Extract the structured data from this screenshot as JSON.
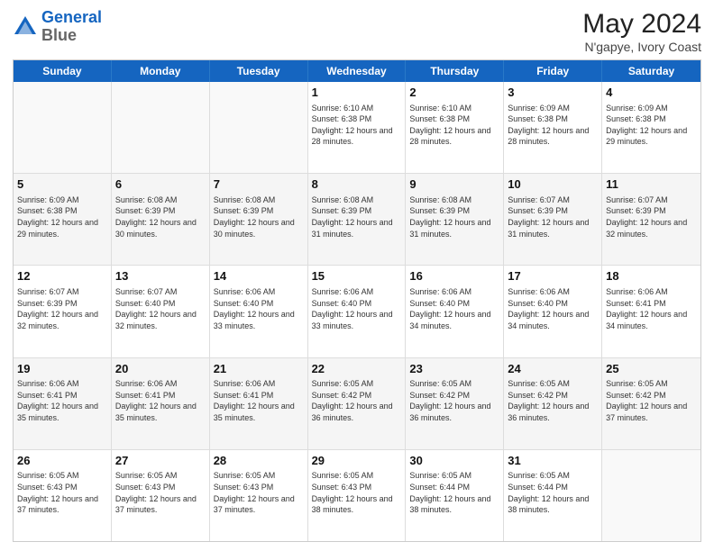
{
  "header": {
    "logo_line1": "General",
    "logo_line2": "Blue",
    "month_year": "May 2024",
    "location": "N'gapye, Ivory Coast"
  },
  "days_of_week": [
    "Sunday",
    "Monday",
    "Tuesday",
    "Wednesday",
    "Thursday",
    "Friday",
    "Saturday"
  ],
  "weeks": [
    [
      {
        "day": "",
        "sunrise": "",
        "sunset": "",
        "daylight": "",
        "empty": true
      },
      {
        "day": "",
        "sunrise": "",
        "sunset": "",
        "daylight": "",
        "empty": true
      },
      {
        "day": "",
        "sunrise": "",
        "sunset": "",
        "daylight": "",
        "empty": true
      },
      {
        "day": "1",
        "sunrise": "Sunrise: 6:10 AM",
        "sunset": "Sunset: 6:38 PM",
        "daylight": "Daylight: 12 hours and 28 minutes."
      },
      {
        "day": "2",
        "sunrise": "Sunrise: 6:10 AM",
        "sunset": "Sunset: 6:38 PM",
        "daylight": "Daylight: 12 hours and 28 minutes."
      },
      {
        "day": "3",
        "sunrise": "Sunrise: 6:09 AM",
        "sunset": "Sunset: 6:38 PM",
        "daylight": "Daylight: 12 hours and 28 minutes."
      },
      {
        "day": "4",
        "sunrise": "Sunrise: 6:09 AM",
        "sunset": "Sunset: 6:38 PM",
        "daylight": "Daylight: 12 hours and 29 minutes."
      }
    ],
    [
      {
        "day": "5",
        "sunrise": "Sunrise: 6:09 AM",
        "sunset": "Sunset: 6:38 PM",
        "daylight": "Daylight: 12 hours and 29 minutes."
      },
      {
        "day": "6",
        "sunrise": "Sunrise: 6:08 AM",
        "sunset": "Sunset: 6:39 PM",
        "daylight": "Daylight: 12 hours and 30 minutes."
      },
      {
        "day": "7",
        "sunrise": "Sunrise: 6:08 AM",
        "sunset": "Sunset: 6:39 PM",
        "daylight": "Daylight: 12 hours and 30 minutes."
      },
      {
        "day": "8",
        "sunrise": "Sunrise: 6:08 AM",
        "sunset": "Sunset: 6:39 PM",
        "daylight": "Daylight: 12 hours and 31 minutes."
      },
      {
        "day": "9",
        "sunrise": "Sunrise: 6:08 AM",
        "sunset": "Sunset: 6:39 PM",
        "daylight": "Daylight: 12 hours and 31 minutes."
      },
      {
        "day": "10",
        "sunrise": "Sunrise: 6:07 AM",
        "sunset": "Sunset: 6:39 PM",
        "daylight": "Daylight: 12 hours and 31 minutes."
      },
      {
        "day": "11",
        "sunrise": "Sunrise: 6:07 AM",
        "sunset": "Sunset: 6:39 PM",
        "daylight": "Daylight: 12 hours and 32 minutes."
      }
    ],
    [
      {
        "day": "12",
        "sunrise": "Sunrise: 6:07 AM",
        "sunset": "Sunset: 6:39 PM",
        "daylight": "Daylight: 12 hours and 32 minutes."
      },
      {
        "day": "13",
        "sunrise": "Sunrise: 6:07 AM",
        "sunset": "Sunset: 6:40 PM",
        "daylight": "Daylight: 12 hours and 32 minutes."
      },
      {
        "day": "14",
        "sunrise": "Sunrise: 6:06 AM",
        "sunset": "Sunset: 6:40 PM",
        "daylight": "Daylight: 12 hours and 33 minutes."
      },
      {
        "day": "15",
        "sunrise": "Sunrise: 6:06 AM",
        "sunset": "Sunset: 6:40 PM",
        "daylight": "Daylight: 12 hours and 33 minutes."
      },
      {
        "day": "16",
        "sunrise": "Sunrise: 6:06 AM",
        "sunset": "Sunset: 6:40 PM",
        "daylight": "Daylight: 12 hours and 34 minutes."
      },
      {
        "day": "17",
        "sunrise": "Sunrise: 6:06 AM",
        "sunset": "Sunset: 6:40 PM",
        "daylight": "Daylight: 12 hours and 34 minutes."
      },
      {
        "day": "18",
        "sunrise": "Sunrise: 6:06 AM",
        "sunset": "Sunset: 6:41 PM",
        "daylight": "Daylight: 12 hours and 34 minutes."
      }
    ],
    [
      {
        "day": "19",
        "sunrise": "Sunrise: 6:06 AM",
        "sunset": "Sunset: 6:41 PM",
        "daylight": "Daylight: 12 hours and 35 minutes."
      },
      {
        "day": "20",
        "sunrise": "Sunrise: 6:06 AM",
        "sunset": "Sunset: 6:41 PM",
        "daylight": "Daylight: 12 hours and 35 minutes."
      },
      {
        "day": "21",
        "sunrise": "Sunrise: 6:06 AM",
        "sunset": "Sunset: 6:41 PM",
        "daylight": "Daylight: 12 hours and 35 minutes."
      },
      {
        "day": "22",
        "sunrise": "Sunrise: 6:05 AM",
        "sunset": "Sunset: 6:42 PM",
        "daylight": "Daylight: 12 hours and 36 minutes."
      },
      {
        "day": "23",
        "sunrise": "Sunrise: 6:05 AM",
        "sunset": "Sunset: 6:42 PM",
        "daylight": "Daylight: 12 hours and 36 minutes."
      },
      {
        "day": "24",
        "sunrise": "Sunrise: 6:05 AM",
        "sunset": "Sunset: 6:42 PM",
        "daylight": "Daylight: 12 hours and 36 minutes."
      },
      {
        "day": "25",
        "sunrise": "Sunrise: 6:05 AM",
        "sunset": "Sunset: 6:42 PM",
        "daylight": "Daylight: 12 hours and 37 minutes."
      }
    ],
    [
      {
        "day": "26",
        "sunrise": "Sunrise: 6:05 AM",
        "sunset": "Sunset: 6:43 PM",
        "daylight": "Daylight: 12 hours and 37 minutes."
      },
      {
        "day": "27",
        "sunrise": "Sunrise: 6:05 AM",
        "sunset": "Sunset: 6:43 PM",
        "daylight": "Daylight: 12 hours and 37 minutes."
      },
      {
        "day": "28",
        "sunrise": "Sunrise: 6:05 AM",
        "sunset": "Sunset: 6:43 PM",
        "daylight": "Daylight: 12 hours and 37 minutes."
      },
      {
        "day": "29",
        "sunrise": "Sunrise: 6:05 AM",
        "sunset": "Sunset: 6:43 PM",
        "daylight": "Daylight: 12 hours and 38 minutes."
      },
      {
        "day": "30",
        "sunrise": "Sunrise: 6:05 AM",
        "sunset": "Sunset: 6:44 PM",
        "daylight": "Daylight: 12 hours and 38 minutes."
      },
      {
        "day": "31",
        "sunrise": "Sunrise: 6:05 AM",
        "sunset": "Sunset: 6:44 PM",
        "daylight": "Daylight: 12 hours and 38 minutes."
      },
      {
        "day": "",
        "sunrise": "",
        "sunset": "",
        "daylight": "",
        "empty": true
      }
    ]
  ]
}
